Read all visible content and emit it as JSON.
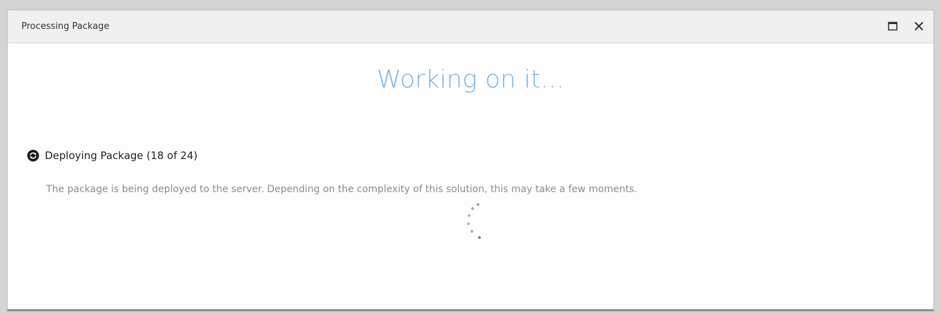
{
  "window": {
    "title": "Processing Package",
    "maximize_icon": "maximize-icon",
    "close_icon": "close-icon"
  },
  "main": {
    "heading": "Working on it...",
    "status": {
      "icon": "sync-icon",
      "title": "Deploying Package (18 of 24)",
      "description": "The package is being deployed to the server. Depending on the complexity of this solution, this may take a few moments."
    },
    "spinner_icon": "loading-spinner-icon"
  },
  "colors": {
    "heading": "#7fb4dd",
    "background": "#fdfdfd",
    "titlebar": "#f0f0f0",
    "description": "#8c8c8c"
  }
}
